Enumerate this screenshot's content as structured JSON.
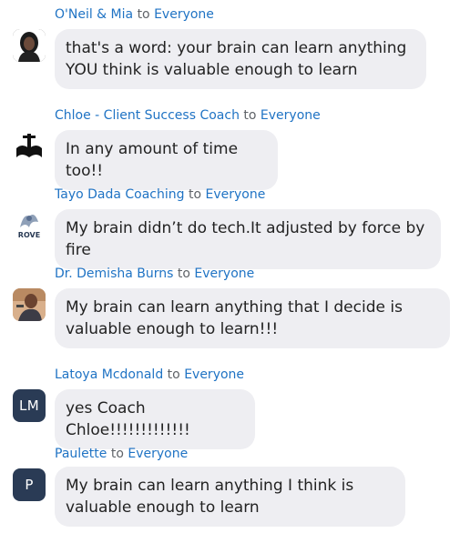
{
  "messages": [
    {
      "sender": "O'Neil & Mia",
      "to_word": "to",
      "recipient": "Everyone",
      "text": "that's a word: your brain can learn anything YOU think is valuable enough to learn",
      "avatar": "photo"
    },
    {
      "sender": "Chloe - Client Success Coach",
      "to_word": "to",
      "recipient": "Everyone",
      "text": "In any amount of time too!!",
      "avatar": "logo"
    },
    {
      "sender": "Tayo Dada Coaching",
      "to_word": "to",
      "recipient": "Everyone",
      "text": "My brain didn’t do tech.It adjusted by force by fire",
      "avatar": "logo",
      "avatar_logo_text": "ROVE"
    },
    {
      "sender": "Dr. Demisha Burns",
      "to_word": "to",
      "recipient": "Everyone",
      "text": "My brain can learn anything that I decide is valuable enough to learn!!!",
      "avatar": "photo"
    },
    {
      "sender": "Latoya Mcdonald",
      "to_word": "to",
      "recipient": "Everyone",
      "text": "yes Coach Chloe!!!!!!!!!!!!!",
      "avatar": "initials",
      "initials": "LM"
    },
    {
      "sender": "Paulette",
      "to_word": "to",
      "recipient": "Everyone",
      "text": "My brain can learn anything I think is valuable enough to learn",
      "avatar": "initials",
      "initials": "P"
    }
  ],
  "colors": {
    "link": "#1f73c4",
    "bubble": "#eeeef2",
    "initials_bg": "#2a3b55"
  }
}
